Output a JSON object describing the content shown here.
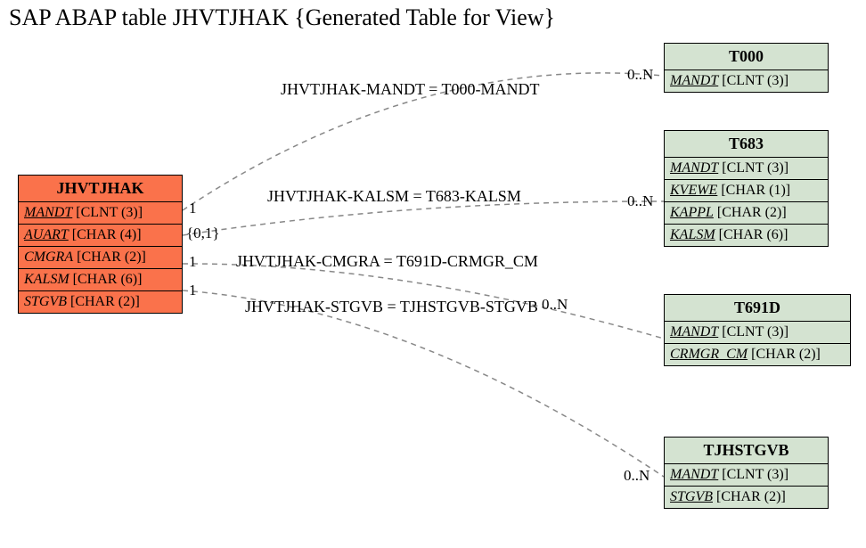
{
  "title": "SAP ABAP table JHVTJHAK {Generated Table for View}",
  "main": {
    "name": "JHVTJHAK",
    "rows": [
      {
        "field": "MANDT",
        "type": "[CLNT (3)]",
        "key": true
      },
      {
        "field": "AUART",
        "type": "[CHAR (4)]",
        "key": true
      },
      {
        "field": "CMGRA",
        "type": "[CHAR (2)]",
        "key": false
      },
      {
        "field": "KALSM",
        "type": "[CHAR (6)]",
        "key": false
      },
      {
        "field": "STGVB",
        "type": "[CHAR (2)]",
        "key": false
      }
    ]
  },
  "targets": [
    {
      "name": "T000",
      "rows": [
        {
          "field": "MANDT",
          "type": "[CLNT (3)]",
          "key": true
        }
      ]
    },
    {
      "name": "T683",
      "rows": [
        {
          "field": "MANDT",
          "type": "[CLNT (3)]",
          "key": true
        },
        {
          "field": "KVEWE",
          "type": "[CHAR (1)]",
          "key": true
        },
        {
          "field": "KAPPL",
          "type": "[CHAR (2)]",
          "key": true
        },
        {
          "field": "KALSM",
          "type": "[CHAR (6)]",
          "key": true
        }
      ]
    },
    {
      "name": "T691D",
      "rows": [
        {
          "field": "MANDT",
          "type": "[CLNT (3)]",
          "key": true
        },
        {
          "field": "CRMGR_CM",
          "type": "[CHAR (2)]",
          "key": true
        }
      ]
    },
    {
      "name": "TJHSTGVB",
      "rows": [
        {
          "field": "MANDT",
          "type": "[CLNT (3)]",
          "key": true
        },
        {
          "field": "STGVB",
          "type": "[CHAR (2)]",
          "key": true
        }
      ]
    }
  ],
  "relations": [
    {
      "label": "JHVTJHAK-MANDT = T000-MANDT",
      "left": "1",
      "right": "0..N"
    },
    {
      "label": "JHVTJHAK-KALSM = T683-KALSM",
      "left": "{0,1}",
      "right": "0..N"
    },
    {
      "label": "JHVTJHAK-CMGRA = T691D-CRMGR_CM",
      "left": "1",
      "right": "0..N"
    },
    {
      "label": "JHVTJHAK-STGVB = TJHSTGVB-STGVB",
      "left": "1",
      "right": "0..N"
    }
  ]
}
